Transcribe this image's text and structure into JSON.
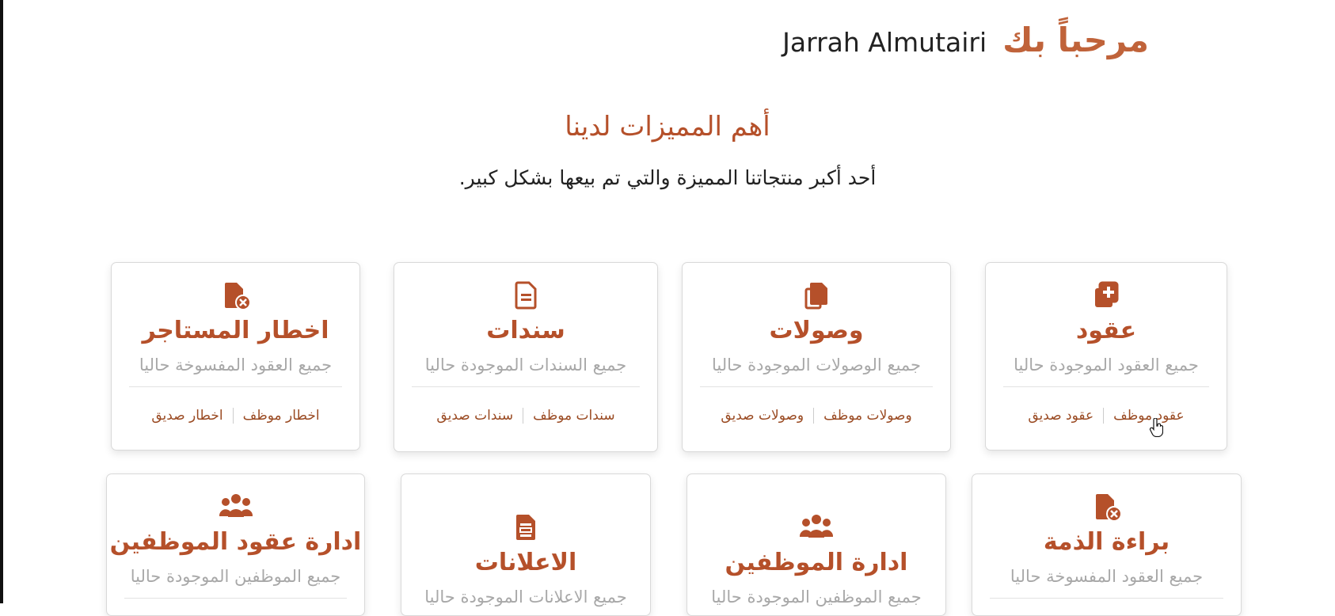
{
  "header": {
    "greeting": "مرحباً بك",
    "user_name": "Jarrah Almutairi"
  },
  "features": {
    "title": "أهم المميزات لدينا",
    "subtitle": "أحد أكبر منتجاتنا المميزة والتي تم بيعها بشكل كبير."
  },
  "cards": [
    {
      "icon": "file-plus-icon",
      "title": "عقود",
      "desc": "جميع العقود الموجودة حاليا",
      "link1": "عقود موظف",
      "link2": "عقود صديق"
    },
    {
      "icon": "copy-icon",
      "title": "وصولات",
      "desc": "جميع الوصولات الموجودة حاليا",
      "link1": "وصولات موظف",
      "link2": "وصولات صديق"
    },
    {
      "icon": "document-icon",
      "title": "سندات",
      "desc": "جميع السندات الموجودة حاليا",
      "link1": "سندات موظف",
      "link2": "سندات صديق"
    },
    {
      "icon": "file-cancel-icon",
      "title": "اخطار المستاجر",
      "desc": "جميع العقود المفسوخة حاليا",
      "link1": "اخطار موظف",
      "link2": "اخطار صديق"
    },
    {
      "icon": "file-cancel-icon",
      "title": "براءة الذمة",
      "desc": "جميع العقود المفسوخة حاليا"
    },
    {
      "icon": "users-icon",
      "title": "ادارة الموظفين",
      "desc": "جميع الموظفين الموجودة حاليا"
    },
    {
      "icon": "document-lines-icon",
      "title": "الاعلانات",
      "desc": "جميع الاعلانات الموجودة حاليا"
    },
    {
      "icon": "users-icon",
      "title": "ادارة عقود الموظفين",
      "desc": "جميع الموظفين الموجودة حاليا"
    }
  ],
  "colors": {
    "accent": "#b5502a",
    "greeting": "#c0633a",
    "link": "#9a4a22",
    "muted": "#a8a8a8"
  }
}
